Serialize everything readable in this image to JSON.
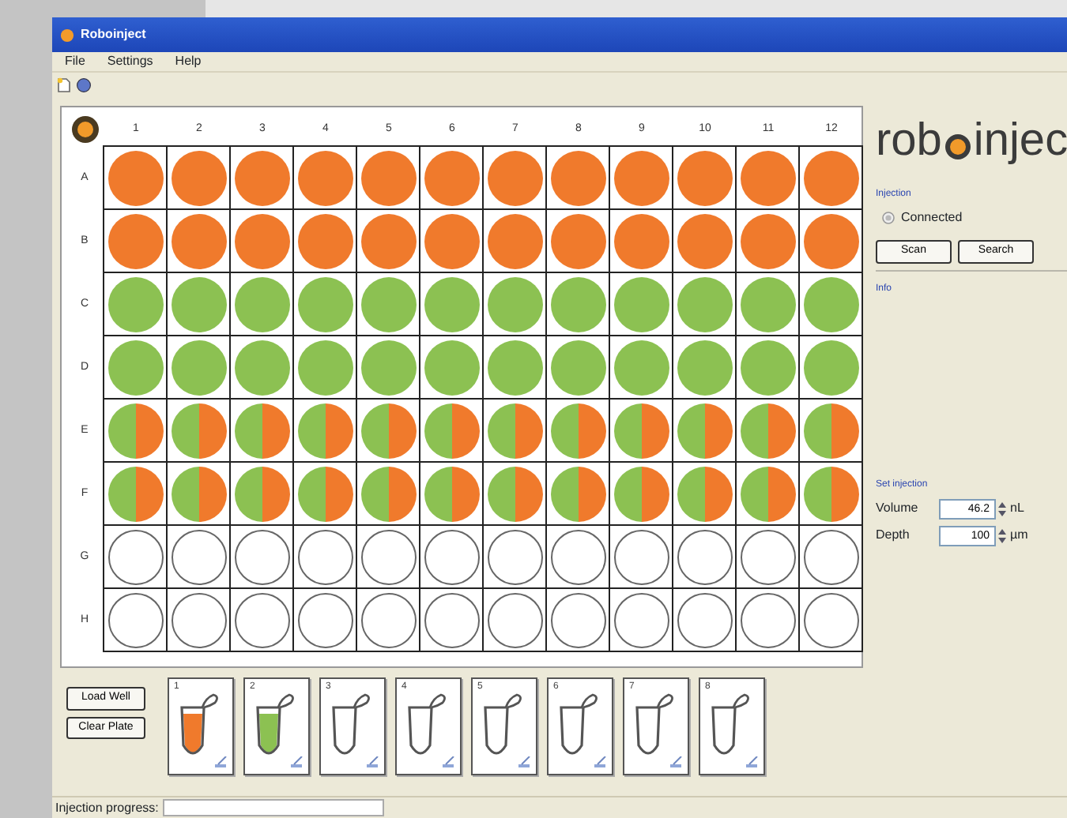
{
  "window": {
    "title": "Roboinject"
  },
  "menu": [
    "File",
    "Settings",
    "Help"
  ],
  "plate": {
    "columns": [
      "1",
      "2",
      "3",
      "4",
      "5",
      "6",
      "7",
      "8",
      "9",
      "10",
      "11",
      "12"
    ],
    "rows": [
      {
        "label": "A",
        "kind": "orange"
      },
      {
        "label": "B",
        "kind": "orange"
      },
      {
        "label": "C",
        "kind": "green"
      },
      {
        "label": "D",
        "kind": "green"
      },
      {
        "label": "E",
        "kind": "half"
      },
      {
        "label": "F",
        "kind": "half"
      },
      {
        "label": "G",
        "kind": "empty"
      },
      {
        "label": "H",
        "kind": "empty"
      }
    ]
  },
  "logo": {
    "left": "rob",
    "right": "injec"
  },
  "injection": {
    "title": "Injection",
    "status": "Connected",
    "connected": false,
    "buttons": [
      "Scan",
      "Search"
    ]
  },
  "info": {
    "title": "Info"
  },
  "set_injection": {
    "title": "Set injection",
    "fields": [
      {
        "label": "Volume",
        "value": "46.2",
        "unit": "nL"
      },
      {
        "label": "Depth",
        "value": "100",
        "unit": "µm"
      }
    ]
  },
  "plate_buttons": [
    "Load Well",
    "Clear Plate"
  ],
  "tubes": [
    {
      "number": "1",
      "kind": "orange"
    },
    {
      "number": "2",
      "kind": "green"
    },
    {
      "number": "3",
      "kind": "empty"
    },
    {
      "number": "4",
      "kind": "empty"
    },
    {
      "number": "5",
      "kind": "empty"
    },
    {
      "number": "6",
      "kind": "empty"
    },
    {
      "number": "7",
      "kind": "empty"
    },
    {
      "number": "8",
      "kind": "empty"
    }
  ],
  "status_bar": {
    "label": "Injection progress:"
  }
}
